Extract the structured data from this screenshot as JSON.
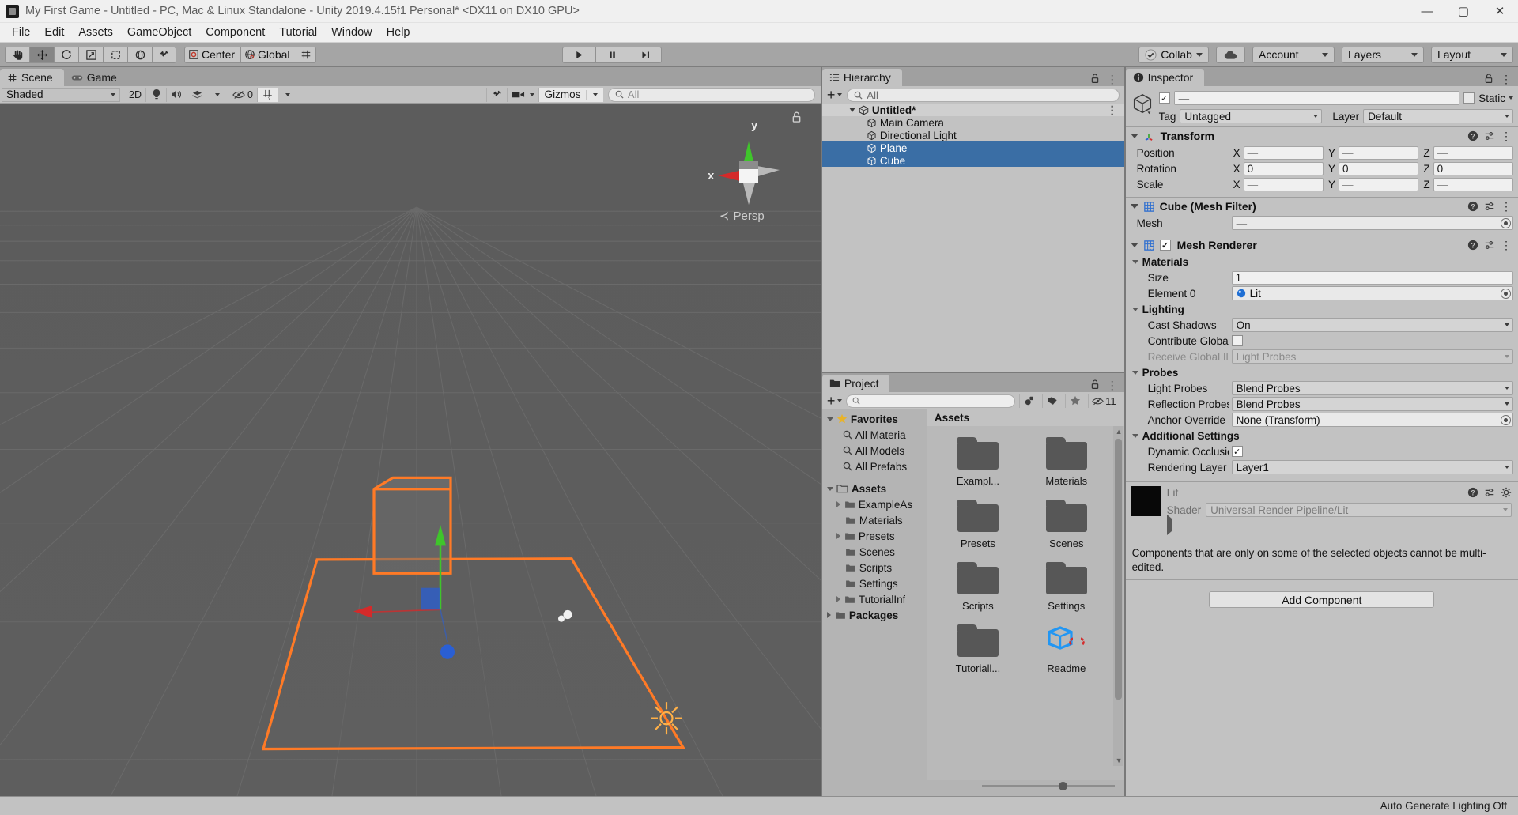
{
  "window": {
    "title": "My First Game - Untitled - PC, Mac & Linux Standalone - Unity 2019.4.15f1 Personal* <DX11 on DX10 GPU>",
    "minimize": "—",
    "maximize": "▢",
    "close": "✕"
  },
  "menubar": {
    "items": [
      "File",
      "Edit",
      "Assets",
      "GameObject",
      "Component",
      "Tutorial",
      "Window",
      "Help"
    ]
  },
  "toolbar": {
    "tools": [
      {
        "name": "hand-tool",
        "glyph": "✋"
      },
      {
        "name": "move-tool",
        "glyph": "✛"
      },
      {
        "name": "rotate-tool",
        "glyph": "↺"
      },
      {
        "name": "scale-tool",
        "glyph": "⇱"
      },
      {
        "name": "rect-tool",
        "glyph": "▣"
      },
      {
        "name": "transform-tool",
        "glyph": "✥"
      },
      {
        "name": "custom-tool",
        "glyph": "⚒"
      }
    ],
    "pivot_label": "Center",
    "space_label": "Global",
    "grid_label": "⌗",
    "play": "▶",
    "pause": "❚❚",
    "step": "▶❚",
    "collab_label": "Collab",
    "cloud_label": "☁",
    "account_label": "Account",
    "layers_label": "Layers",
    "layout_label": "Layout"
  },
  "scene_panel": {
    "tabs": [
      {
        "label": "Scene",
        "selected": true,
        "icon": "grid-icon"
      },
      {
        "label": "Game",
        "selected": false,
        "icon": "gamepad-icon"
      }
    ],
    "draw_mode": "Shaded",
    "twod_label": "2D",
    "lighting_icon": "lightbulb-icon",
    "audio_icon": "speaker-icon",
    "effects_icon": "effects-icon",
    "hidden_count": "0",
    "grid_icon": "scene-grid-icon",
    "tool_icon": "wrench-icon",
    "camera_icon": "camera-icon",
    "gizmos_label": "Gizmos",
    "search_placeholder": "All",
    "gizmo": {
      "axis_y": "y",
      "axis_x": "x",
      "projection": "Persp",
      "persp_arrow": "≺"
    }
  },
  "hierarchy": {
    "tab_label": "Hierarchy",
    "add_label": "+",
    "search_placeholder": "All",
    "items": [
      {
        "label": "Untitled*",
        "depth": 0,
        "root": true,
        "selected": false
      },
      {
        "label": "Main Camera",
        "depth": 1,
        "root": false,
        "selected": false
      },
      {
        "label": "Directional Light",
        "depth": 1,
        "root": false,
        "selected": false
      },
      {
        "label": "Plane",
        "depth": 1,
        "root": false,
        "selected": true
      },
      {
        "label": "Cube",
        "depth": 1,
        "root": false,
        "selected": true
      }
    ]
  },
  "project": {
    "tab_label": "Project",
    "add_label": "+",
    "search_placeholder": "",
    "hidden_count": "11",
    "breadcrumb": "Assets",
    "favorites_label": "Favorites",
    "favorites": [
      "All Materia",
      "All Models",
      "All Prefabs"
    ],
    "tree": [
      {
        "label": "Assets",
        "depth": 0,
        "bold": true,
        "expanded": true,
        "arrow": "down"
      },
      {
        "label": "ExampleAs",
        "depth": 1,
        "bold": false,
        "expanded": false,
        "arrow": "right"
      },
      {
        "label": "Materials",
        "depth": 1,
        "bold": false,
        "expanded": false,
        "arrow": "none"
      },
      {
        "label": "Presets",
        "depth": 1,
        "bold": false,
        "expanded": false,
        "arrow": "right"
      },
      {
        "label": "Scenes",
        "depth": 1,
        "bold": false,
        "expanded": false,
        "arrow": "none"
      },
      {
        "label": "Scripts",
        "depth": 1,
        "bold": false,
        "expanded": false,
        "arrow": "none"
      },
      {
        "label": "Settings",
        "depth": 1,
        "bold": false,
        "expanded": false,
        "arrow": "none"
      },
      {
        "label": "TutorialInf",
        "depth": 1,
        "bold": false,
        "expanded": false,
        "arrow": "right"
      },
      {
        "label": "Packages",
        "depth": 0,
        "bold": true,
        "expanded": false,
        "arrow": "right"
      }
    ],
    "assets": [
      {
        "label": "Exampl...",
        "type": "folder"
      },
      {
        "label": "Materials",
        "type": "folder"
      },
      {
        "label": "Presets",
        "type": "folder"
      },
      {
        "label": "Scenes",
        "type": "folder"
      },
      {
        "label": "Scripts",
        "type": "folder"
      },
      {
        "label": "Settings",
        "type": "folder"
      },
      {
        "label": "Tutoriall...",
        "type": "folder"
      },
      {
        "label": "Readme",
        "type": "readme"
      }
    ]
  },
  "inspector": {
    "tab_label": "Inspector",
    "name_value": "—",
    "static_label": "Static",
    "tag_label": "Tag",
    "tag_value": "Untagged",
    "layer_label": "Layer",
    "layer_value": "Default",
    "transform": {
      "title": "Transform",
      "rows": [
        {
          "label": "Position",
          "x": "—",
          "y": "—",
          "z": "—",
          "dim": true
        },
        {
          "label": "Rotation",
          "x": "0",
          "y": "0",
          "z": "0",
          "dim": false
        },
        {
          "label": "Scale",
          "x": "—",
          "y": "—",
          "z": "—",
          "dim": true
        }
      ],
      "axis_labels": [
        "X",
        "Y",
        "Z"
      ]
    },
    "mesh_filter": {
      "title": "Cube (Mesh Filter)",
      "mesh_label": "Mesh",
      "mesh_value": "—"
    },
    "mesh_renderer": {
      "title": "Mesh Renderer",
      "materials_label": "Materials",
      "size_label": "Size",
      "size_value": "1",
      "element_label": "Element 0",
      "element_value": "Lit",
      "lighting_label": "Lighting",
      "cast_shadows_label": "Cast Shadows",
      "cast_shadows_value": "On",
      "contribute_gi_label": "Contribute Global Illu",
      "receive_gi_label": "Receive Global Illum",
      "receive_gi_value": "Light Probes",
      "probes_label": "Probes",
      "light_probes_label": "Light Probes",
      "light_probes_value": "Blend Probes",
      "reflection_probes_label": "Reflection Probes",
      "reflection_probes_value": "Blend Probes",
      "anchor_override_label": "Anchor Override",
      "anchor_override_value": "None (Transform)",
      "additional_settings_label": "Additional Settings",
      "dynamic_occlusion_label": "Dynamic Occlusion",
      "rendering_layer_label": "Rendering Layer Ma",
      "rendering_layer_value": "Layer1"
    },
    "material": {
      "name": "Lit",
      "shader_label": "Shader",
      "shader_value": "Universal Render Pipeline/Lit",
      "swatch_color": "#080808"
    },
    "message": "Components that are only on some of the selected objects cannot be multi-edited.",
    "add_component_label": "Add Component"
  },
  "statusbar": {
    "text": "Auto Generate Lighting Off"
  },
  "colors": {
    "selection_outline": "#ff7a26",
    "hierarchy_selection": "#3a6ea5",
    "axis_x": "#d42a2a",
    "axis_y": "#3fc52b",
    "axis_z": "#2a5fd4",
    "panel_bg": "#c2c2c2",
    "toolbar_bg": "#a5a5a5",
    "viewport_bg": "#5a5a5a"
  }
}
